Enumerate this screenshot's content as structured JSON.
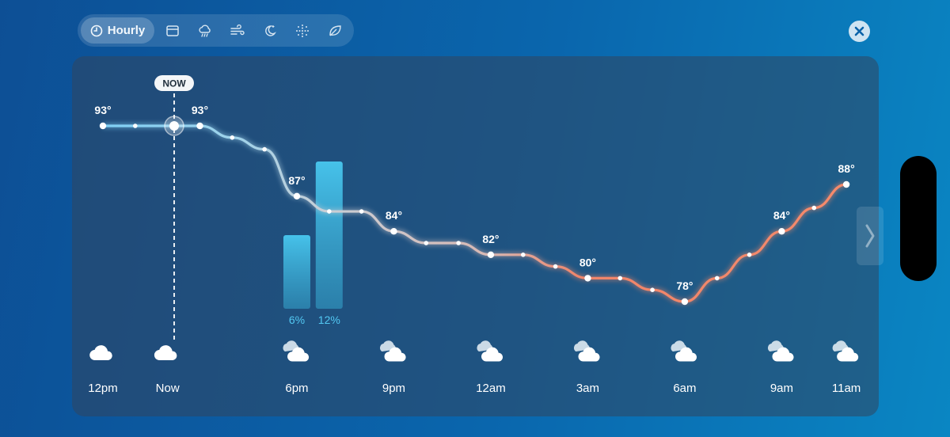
{
  "toolbar": {
    "active_tab_label": "Hourly",
    "tabs": [
      {
        "id": "hourly",
        "icon": "clock-icon"
      },
      {
        "id": "calendar",
        "icon": "calendar-icon"
      },
      {
        "id": "precipitation",
        "icon": "rain-cloud-icon"
      },
      {
        "id": "wind",
        "icon": "wind-icon"
      },
      {
        "id": "night",
        "icon": "moon-stars-icon"
      },
      {
        "id": "snow",
        "icon": "snowflake-icon"
      },
      {
        "id": "air-quality",
        "icon": "leaf-icon"
      }
    ]
  },
  "now_badge": "NOW",
  "colors": {
    "cool_line": "#7fd0f5",
    "neutral_line": "#c9cfd6",
    "warm_line": "#f0856a",
    "precip_bar": "#42bde6",
    "precip_text": "#52c8f2"
  },
  "chart_data": {
    "type": "line",
    "unit": "°F",
    "points": [
      {
        "hour": "12pm",
        "temp": 93,
        "label": "93°"
      },
      {
        "hour": "1pm",
        "temp": 93
      },
      {
        "hour": "Now",
        "temp": 93
      },
      {
        "hour": "3pm",
        "temp": 93,
        "label": "93°"
      },
      {
        "hour": "4pm",
        "temp": 92
      },
      {
        "hour": "5pm",
        "temp": 91
      },
      {
        "hour": "6pm",
        "temp": 87,
        "label": "87°"
      },
      {
        "hour": "7pm",
        "temp": 85.7
      },
      {
        "hour": "8pm",
        "temp": 85.7
      },
      {
        "hour": "9pm",
        "temp": 84,
        "label": "84°"
      },
      {
        "hour": "10pm",
        "temp": 83
      },
      {
        "hour": "11pm",
        "temp": 83
      },
      {
        "hour": "12am",
        "temp": 82,
        "label": "82°"
      },
      {
        "hour": "1am",
        "temp": 82
      },
      {
        "hour": "2am",
        "temp": 81
      },
      {
        "hour": "3am",
        "temp": 80,
        "label": "80°"
      },
      {
        "hour": "4am",
        "temp": 80
      },
      {
        "hour": "5am",
        "temp": 79
      },
      {
        "hour": "6am",
        "temp": 78,
        "label": "78°"
      },
      {
        "hour": "7am",
        "temp": 80
      },
      {
        "hour": "8am",
        "temp": 82
      },
      {
        "hour": "9am",
        "temp": 84,
        "label": "84°"
      },
      {
        "hour": "10am",
        "temp": 86
      },
      {
        "hour": "11am",
        "temp": 88,
        "label": "88°"
      }
    ],
    "precipitation": [
      {
        "hour": "6pm",
        "chance": 6,
        "label": "6%"
      },
      {
        "hour": "7pm",
        "chance": 12,
        "label": "12%"
      }
    ],
    "x_labels": [
      {
        "label": "12pm",
        "icon": "cloud-icon"
      },
      {
        "label": "Now",
        "icon": "cloud-icon"
      },
      {
        "label": "6pm",
        "icon": "partly-cloudy-icon"
      },
      {
        "label": "9pm",
        "icon": "partly-cloudy-icon"
      },
      {
        "label": "12am",
        "icon": "partly-cloudy-icon"
      },
      {
        "label": "3am",
        "icon": "partly-cloudy-icon"
      },
      {
        "label": "6am",
        "icon": "partly-cloudy-icon"
      },
      {
        "label": "9am",
        "icon": "partly-cloudy-icon"
      },
      {
        "label": "11am",
        "icon": "partly-cloudy-icon"
      }
    ]
  }
}
